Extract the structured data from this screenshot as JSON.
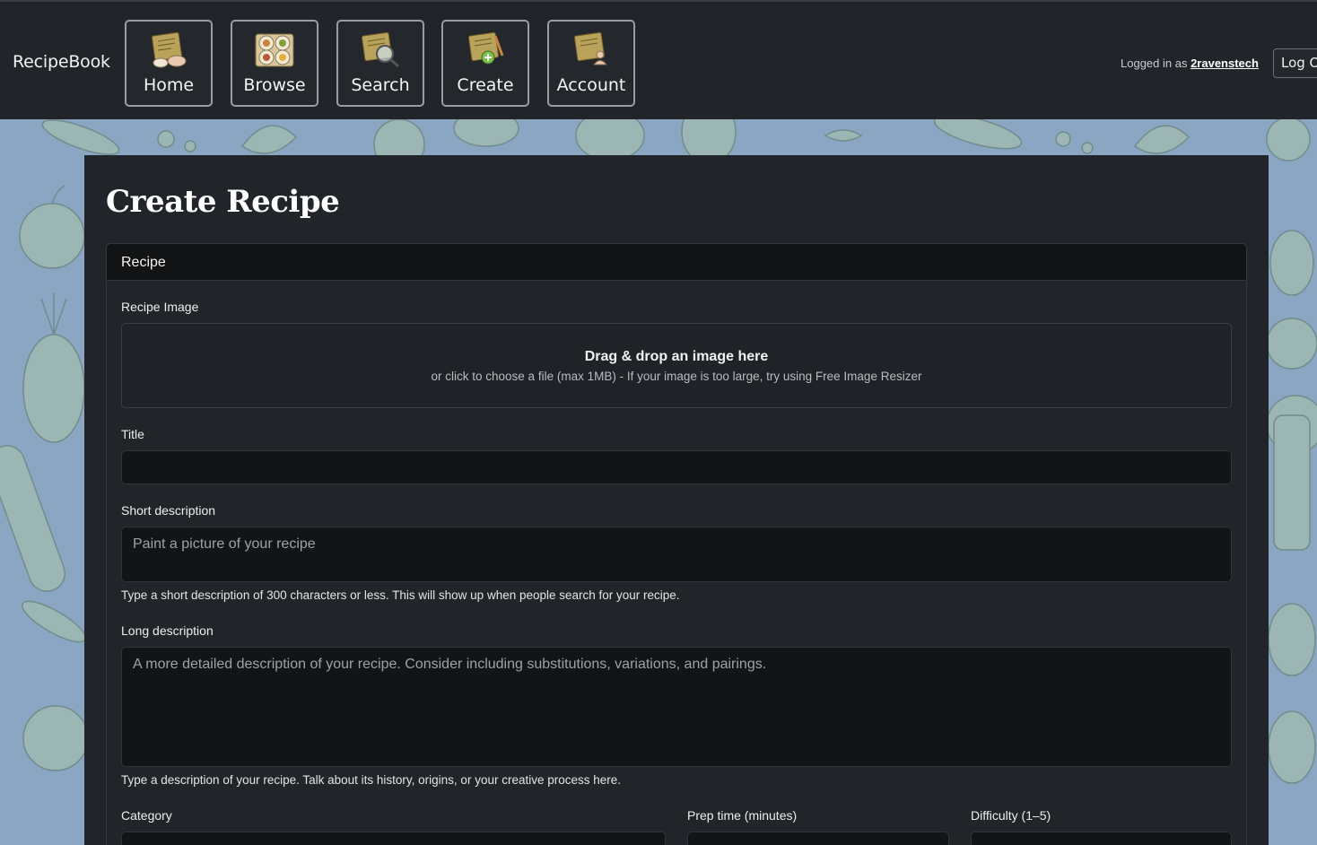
{
  "nav": {
    "brand": "RecipeBook",
    "items": [
      {
        "label": "Home",
        "icon": "recipe-card-home-icon"
      },
      {
        "label": "Browse",
        "icon": "food-plates-icon"
      },
      {
        "label": "Search",
        "icon": "magnifier-recipe-icon"
      },
      {
        "label": "Create",
        "icon": "recipe-card-add-icon"
      },
      {
        "label": "Account",
        "icon": "recipe-card-user-icon"
      }
    ],
    "logged_in_prefix": "Logged in as",
    "username": "2ravenstech",
    "logout_label": "Log Out"
  },
  "page": {
    "title": "Create Recipe"
  },
  "form": {
    "section_header": "Recipe",
    "image": {
      "label": "Recipe Image",
      "dropzone_title": "Drag & drop an image here",
      "dropzone_sub": "or click to choose a file (max 1MB) - If your image is too large, try using Free Image Resizer"
    },
    "title": {
      "label": "Title",
      "value": "",
      "placeholder": ""
    },
    "short_description": {
      "label": "Short description",
      "placeholder": "Paint a picture of your recipe",
      "help": "Type a short description of 300 characters or less. This will show up when people search for your recipe."
    },
    "long_description": {
      "label": "Long description",
      "placeholder": "A more detailed description of your recipe. Consider including substitutions, variations, and pairings.",
      "help": "Type a description of your recipe. Talk about its history, origins, or your creative process here."
    },
    "category": {
      "label": "Category"
    },
    "prep_time": {
      "label": "Prep time (minutes)"
    },
    "difficulty": {
      "label": "Difficulty (1–5)"
    }
  },
  "colors": {
    "nav_bg": "#212429",
    "panel_bg": "#212429",
    "input_bg": "#131416",
    "page_bg": "#8aa6c3"
  }
}
